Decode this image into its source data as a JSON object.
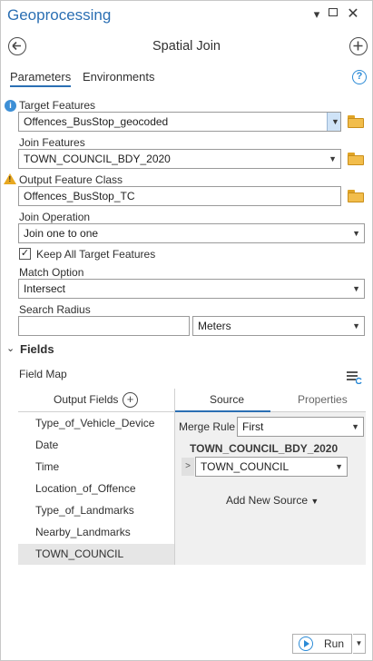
{
  "window": {
    "title": "Geoprocessing"
  },
  "tool": {
    "title": "Spatial Join"
  },
  "tabs": [
    {
      "label": "Parameters",
      "active": true
    },
    {
      "label": "Environments",
      "active": false
    }
  ],
  "params": {
    "target_features": {
      "label": "Target Features",
      "value": "Offences_BusStop_geocoded"
    },
    "join_features": {
      "label": "Join Features",
      "value": "TOWN_COUNCIL_BDY_2020"
    },
    "output_feature_class": {
      "label": "Output Feature Class",
      "value": "Offences_BusStop_TC"
    },
    "join_operation": {
      "label": "Join Operation",
      "value": "Join one to one"
    },
    "keep_all": {
      "label": "Keep All Target Features",
      "checked": true
    },
    "match_option": {
      "label": "Match Option",
      "value": "Intersect"
    },
    "search_radius": {
      "label": "Search Radius",
      "value": "",
      "unit": "Meters"
    }
  },
  "fields_section": {
    "label": "Fields",
    "field_map_label": "Field Map",
    "output_fields_label": "Output Fields",
    "output_fields": [
      "Type_of_Vehicle_Device",
      "Date",
      "Time",
      "Location_of_Offence",
      "Type_of_Landmarks",
      "Nearby_Landmarks",
      "TOWN_COUNCIL"
    ],
    "selected_field": "TOWN_COUNCIL",
    "right_tabs": [
      "Source",
      "Properties"
    ],
    "merge_rule_label": "Merge Rule",
    "merge_rule_value": "First",
    "source_name": "TOWN_COUNCIL_BDY_2020",
    "source_field": "TOWN_COUNCIL",
    "add_new_source": "Add New Source"
  },
  "footer": {
    "run_label": "Run"
  },
  "icons": {
    "back": "arrow-left-circle",
    "add": "plus-circle",
    "help": "question-circle",
    "info": "info-circle",
    "warning": "warning-triangle",
    "browse": "folder"
  },
  "colors": {
    "accent": "#2b6fb3",
    "info": "#3d8fd6",
    "warning": "#e8a820",
    "folder": "#f2bd4b"
  }
}
